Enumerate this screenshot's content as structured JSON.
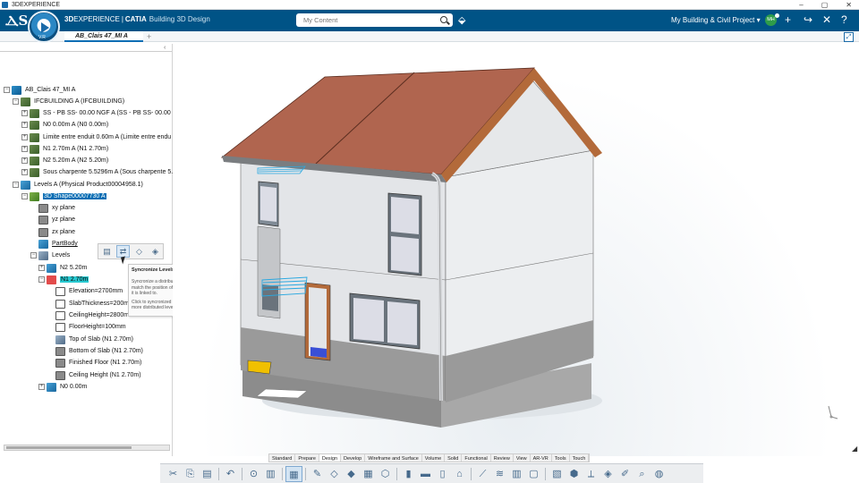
{
  "window": {
    "title": "3DEXPERIENCE",
    "minimize": "–",
    "maximize": "▢",
    "close": "✕"
  },
  "header": {
    "brand_prefix": "3D",
    "brand_main": "EXPERIENCE",
    "brand_sep": "|",
    "brand_product": "CATIA",
    "app_name": "Building 3D Design",
    "compass_version": "V.R",
    "search_placeholder": "My Content",
    "project": "My Building & Civil Project ▾",
    "avatar_initials": "MH",
    "colors": {
      "header_bg": "#005386",
      "accent": "#0a6eb4"
    }
  },
  "tabs": [
    {
      "label": "AB_Clais 47_MI A"
    }
  ],
  "tab_add": "+",
  "tree": {
    "root": "AB_Clais 47_MI A",
    "ifc_building": "IFCBUILDING A (IFCBUILDING)",
    "ss_pb": "SS - PB SS- 00.00 NGF A (SS - PB SS- 00.00 NC",
    "n0_level": "N0 0.00m A (N0 0.00m)",
    "limite": "Limite entre enduit 0.60m A (Limite entre endu",
    "n1_level": "N1 2.70m A (N1 2.70m)",
    "n2_level": "N2 5.20m A (N2 5.20m)",
    "sous_charpente": "Sous charpente 5.5296m A (Sous charpente 5.5",
    "levels_pp": "Levels A (Physical Product00004958.1)",
    "shape": "3D Shape00007730 A",
    "xy": "xy plane",
    "yz": "yz plane",
    "zx": "zx plane",
    "partbody": "PartBody",
    "levels": "Levels",
    "n2": "N2 5.20m",
    "n1": "N1 2.70m",
    "elevation": "Elevation=2700mm",
    "slab": "SlabThickness=200mm",
    "ceiling_h": "CeilingHeight=2800mm",
    "floor_h": "FloorHeight=100mm",
    "top_slab": "Top of Slab (N1 2.70m)",
    "bottom_slab": "Bottom of Slab (N1 2.70m)",
    "finished_floor": "Finished Floor (N1 2.70m)",
    "ceiling_height": "Ceiling Height (N1 2.70m)",
    "n0": "N0 0.00m"
  },
  "context_toolbar": {
    "buttons": [
      "level-icon",
      "synchronize-levels-icon",
      "floor-plane-icon",
      "ceiling-plane-icon"
    ]
  },
  "tooltip": {
    "title": "Syncronize Levels",
    "line1": "Syncronize a distributed level to",
    "line2": "match the position of the level",
    "line3": "it is linked to.",
    "line4": "Click to syncronized one or",
    "line5": "more distributed levels."
  },
  "section_tabs": [
    "Standard",
    "Prepare",
    "Design",
    "Develop",
    "Wireframe and Surface",
    "Volume",
    "Solid",
    "Functional",
    "Review",
    "View",
    "AR-VR",
    "Tools",
    "Touch"
  ],
  "active_section_tab": "Design",
  "viewport_colors": {
    "roof": "#b0654f",
    "wall": "#e3e5e8",
    "base": "#9a9a9a",
    "frame": "#b36a3a"
  }
}
